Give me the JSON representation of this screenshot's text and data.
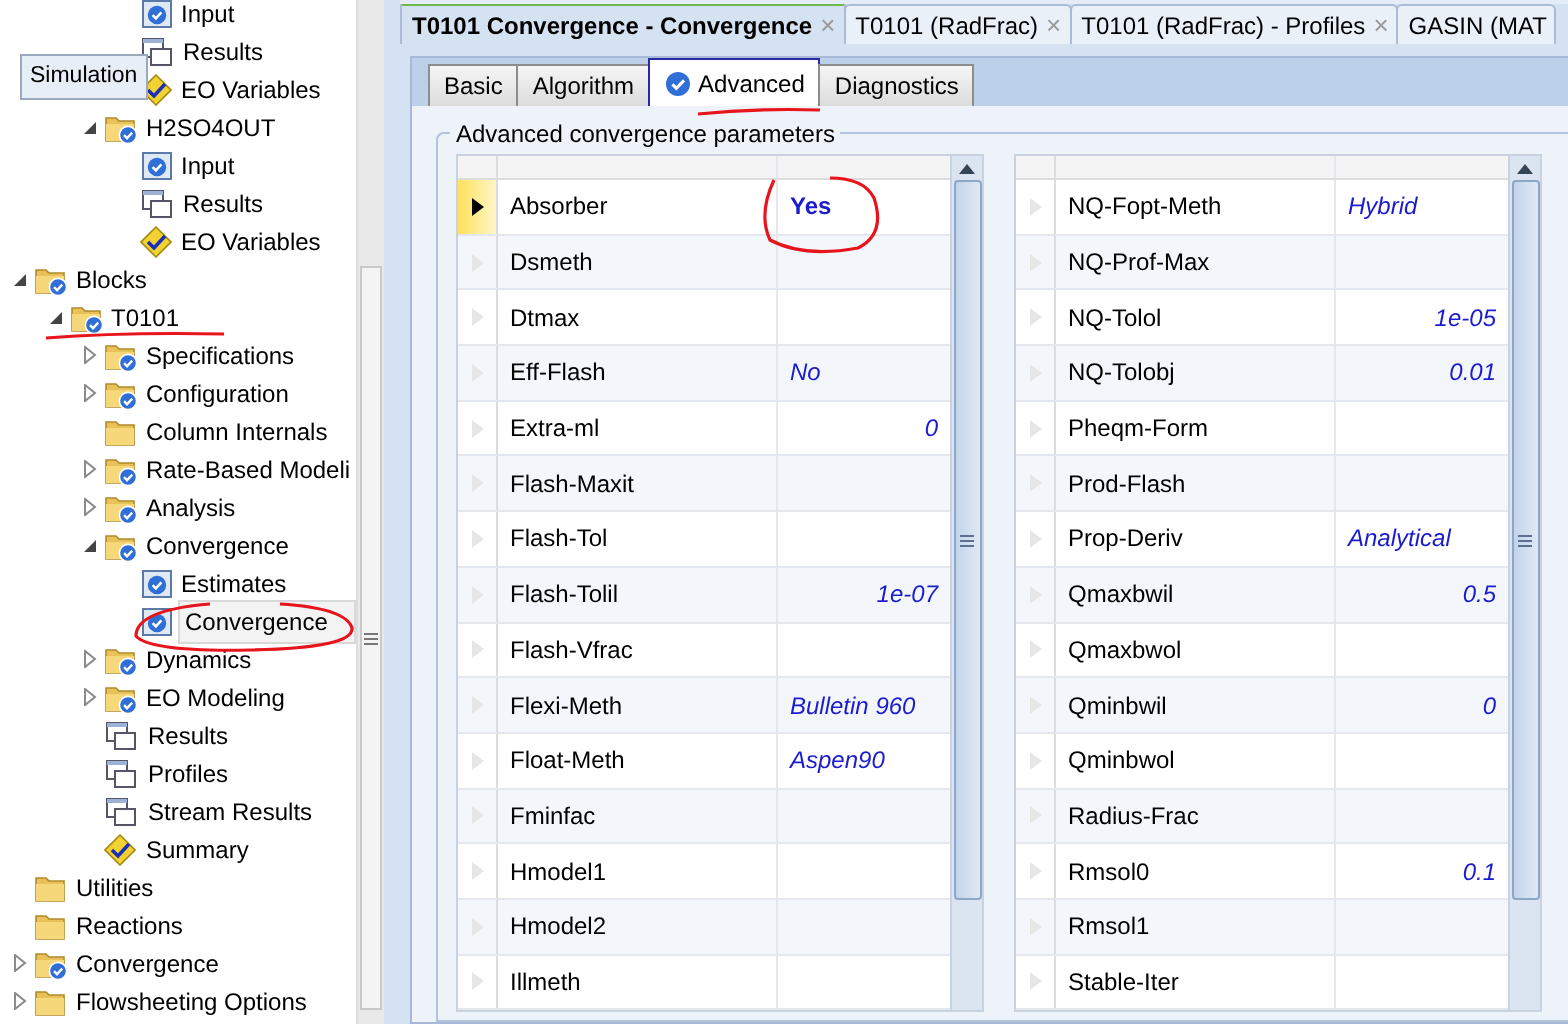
{
  "tooltip": "Simulation",
  "tree": [
    {
      "children": [
        {
          "children": [
            {
              "children": [
                {
                  "label": "Input",
                  "kind": "form",
                  "selected": false
                },
                {
                  "label": "Results",
                  "kind": "results",
                  "selected": false
                },
                {
                  "label": "EO Variables",
                  "kind": "eo",
                  "selected": false
                }
              ]
            },
            {
              "label": "H2SO4OUT",
              "kind": "folder",
              "checked": true,
              "expanded": true,
              "selected": false,
              "children": [
                {
                  "label": "Input",
                  "kind": "form",
                  "selected": false
                },
                {
                  "label": "Results",
                  "kind": "results",
                  "selected": false
                },
                {
                  "label": "EO Variables",
                  "kind": "eo",
                  "selected": false
                }
              ]
            }
          ]
        }
      ]
    },
    {
      "label": "Blocks",
      "kind": "folder",
      "checked": true,
      "expanded": true,
      "selected": false,
      "children": [
        {
          "label": "T0101",
          "kind": "folder",
          "checked": true,
          "expanded": true,
          "selected": false,
          "children": [
            {
              "label": "Specifications",
              "kind": "folder",
              "checked": true,
              "expanded": false,
              "selected": false
            },
            {
              "label": "Configuration",
              "kind": "folder",
              "checked": true,
              "expanded": false,
              "selected": false
            },
            {
              "label": "Column Internals",
              "kind": "folder",
              "checked": false,
              "selected": false
            },
            {
              "label": "Rate-Based Modeli",
              "kind": "folder",
              "checked": true,
              "expanded": false,
              "selected": false
            },
            {
              "label": "Analysis",
              "kind": "folder",
              "checked": true,
              "expanded": false,
              "selected": false
            },
            {
              "label": "Convergence",
              "kind": "folder",
              "checked": true,
              "expanded": true,
              "selected": false,
              "children": [
                {
                  "label": "Estimates",
                  "kind": "form",
                  "selected": false
                },
                {
                  "label": "Convergence",
                  "kind": "form",
                  "selected": true
                }
              ]
            },
            {
              "label": "Dynamics",
              "kind": "folder",
              "checked": true,
              "expanded": false,
              "selected": false
            },
            {
              "label": "EO Modeling",
              "kind": "folder",
              "checked": true,
              "expanded": false,
              "selected": false
            },
            {
              "label": "Results",
              "kind": "results",
              "selected": false
            },
            {
              "label": "Profiles",
              "kind": "results",
              "selected": false
            },
            {
              "label": "Stream Results",
              "kind": "results",
              "selected": false
            },
            {
              "label": "Summary",
              "kind": "eo",
              "selected": false
            }
          ]
        }
      ]
    },
    {
      "label": "Utilities",
      "kind": "folder",
      "checked": false,
      "selected": false
    },
    {
      "label": "Reactions",
      "kind": "folder",
      "checked": false,
      "selected": false
    },
    {
      "label": "Convergence",
      "kind": "folder",
      "checked": true,
      "expanded": false,
      "selected": false
    },
    {
      "label": "Flowsheeting Options",
      "kind": "folder",
      "checked": false,
      "expanded": false,
      "selected": false
    }
  ],
  "document_tabs": [
    {
      "label": "T0101 Convergence - Convergence",
      "selected": true,
      "closable": true
    },
    {
      "label": "T0101 (RadFrac)",
      "selected": false,
      "closable": true
    },
    {
      "label": "T0101 (RadFrac) - Profiles",
      "selected": false,
      "closable": true
    },
    {
      "label": "GASIN (MAT",
      "selected": false,
      "closable": false
    }
  ],
  "close_glyph": "×",
  "tabs": [
    {
      "label": "Basic",
      "selected": false,
      "checked": false
    },
    {
      "label": "Algorithm",
      "selected": false,
      "checked": false
    },
    {
      "label": "Advanced",
      "selected": true,
      "checked": true
    },
    {
      "label": "Diagnostics",
      "selected": false,
      "checked": false
    }
  ],
  "group_title": "Advanced convergence parameters",
  "grids": [
    {
      "rows": [
        {
          "name": "Absorber",
          "value": "Yes",
          "kind": "text",
          "entered": true,
          "selected": true
        },
        {
          "name": "Dsmeth",
          "selected": false
        },
        {
          "name": "Dtmax",
          "selected": false
        },
        {
          "name": "Eff-Flash",
          "value": "No",
          "kind": "text",
          "entered": false,
          "selected": false
        },
        {
          "name": "Extra-ml",
          "value": "0",
          "kind": "number",
          "entered": false,
          "selected": false
        },
        {
          "name": "Flash-Maxit",
          "selected": false
        },
        {
          "name": "Flash-Tol",
          "selected": false
        },
        {
          "name": "Flash-Tolil",
          "value": "1e-07",
          "kind": "number",
          "entered": false,
          "selected": false
        },
        {
          "name": "Flash-Vfrac",
          "selected": false
        },
        {
          "name": "Flexi-Meth",
          "value": "Bulletin 960",
          "kind": "text",
          "entered": false,
          "selected": false
        },
        {
          "name": "Float-Meth",
          "value": "Aspen90",
          "kind": "text",
          "entered": false,
          "selected": false
        },
        {
          "name": "Fminfac",
          "selected": false
        },
        {
          "name": "Hmodel1",
          "selected": false
        },
        {
          "name": "Hmodel2",
          "selected": false
        },
        {
          "name": "Illmeth",
          "selected": false
        }
      ]
    },
    {
      "rows": [
        {
          "name": "NQ-Fopt-Meth",
          "value": "Hybrid",
          "kind": "text",
          "entered": false,
          "selected": false
        },
        {
          "name": "NQ-Prof-Max",
          "selected": false
        },
        {
          "name": "NQ-Tolol",
          "value": "1e-05",
          "kind": "number",
          "entered": false,
          "selected": false
        },
        {
          "name": "NQ-Tolobj",
          "value": "0.01",
          "kind": "number",
          "entered": false,
          "selected": false
        },
        {
          "name": "Pheqm-Form",
          "selected": false
        },
        {
          "name": "Prod-Flash",
          "selected": false
        },
        {
          "name": "Prop-Deriv",
          "value": "Analytical",
          "kind": "text",
          "entered": false,
          "selected": false
        },
        {
          "name": "Qmaxbwil",
          "value": "0.5",
          "kind": "number",
          "entered": false,
          "selected": false
        },
        {
          "name": "Qmaxbwol",
          "selected": false
        },
        {
          "name": "Qminbwil",
          "value": "0",
          "kind": "number",
          "entered": false,
          "selected": false
        },
        {
          "name": "Qminbwol",
          "selected": false
        },
        {
          "name": "Radius-Frac",
          "selected": false
        },
        {
          "name": "Rmsol0",
          "value": "0.1",
          "kind": "number",
          "entered": false,
          "selected": false
        },
        {
          "name": "Rmsol1",
          "selected": false
        },
        {
          "name": "Stable-Iter",
          "selected": false
        }
      ]
    }
  ]
}
